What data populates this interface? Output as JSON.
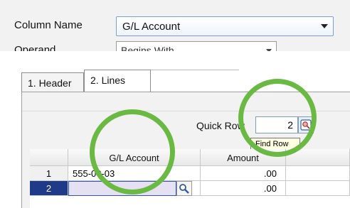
{
  "form": {
    "column_name_label": "Column Name",
    "column_name_value": "G/L Account",
    "operand_label": "Operand",
    "operand_value": "Begins With"
  },
  "tabs": [
    {
      "label": "1. Header",
      "selected": false
    },
    {
      "label": "2. Lines",
      "selected": true
    }
  ],
  "quick_row": {
    "label": "Quick Row",
    "value": "2",
    "find_tooltip": "Find Row"
  },
  "grid": {
    "columns": [
      "",
      "G/L Account",
      "Amount"
    ],
    "rows": [
      {
        "num": "1",
        "account": "555-00-03",
        "amount": ".00"
      },
      {
        "num": "2",
        "account": "",
        "amount": ".00"
      }
    ]
  },
  "icons": {
    "find_row": "find-row-icon",
    "lookup": "magnifier-icon"
  },
  "colors": {
    "highlight_ring": "#69b943",
    "selected_row": "#1f3a88"
  }
}
